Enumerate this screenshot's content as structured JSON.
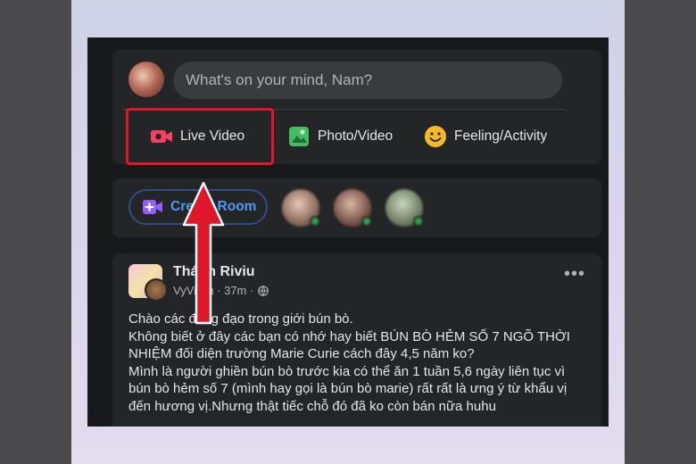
{
  "composer": {
    "placeholder": "What's on your mind, Nam?",
    "actions": [
      {
        "label": "Live Video",
        "icon": "live-video-icon",
        "color": "#f3425f"
      },
      {
        "label": "Photo/Video",
        "icon": "photo-video-icon",
        "color": "#45bd62"
      },
      {
        "label": "Feeling/Activity",
        "icon": "feeling-activity-icon",
        "color": "#f7b928"
      }
    ]
  },
  "rooms": {
    "create_room_label": "Create Room",
    "create_room_icon": "video-camera-plus-icon"
  },
  "post": {
    "author": "Thánh Riviu",
    "sub_author": "VyVi Ph",
    "time": "37m",
    "privacy_icon": "globe-icon",
    "more_icon": "more-options-icon",
    "text": "Chào các đồng đạo trong giới bún bò.\nKhông biết ở đây các bạn có nhớ hay biết BÚN BÒ HẺM SỐ 7 NGÕ THỜI NHIỆM đối diện trường Marie Curie cách đây 4,5 năm ko?\nMình là người ghiền bún bò trước kia có thể ăn 1 tuần 5,6 ngày liên tục vì bún bò hẻm số 7 (mình hay gọi là bún bò marie) rất rất là ưng ý từ khẩu vị đến hương vị.Nhưng thật tiếc chỗ đó đã ko còn bán nữa huhu"
  },
  "colors": {
    "highlight": "#e0162b",
    "online": "#31a24c",
    "link": "#4e9af1"
  }
}
